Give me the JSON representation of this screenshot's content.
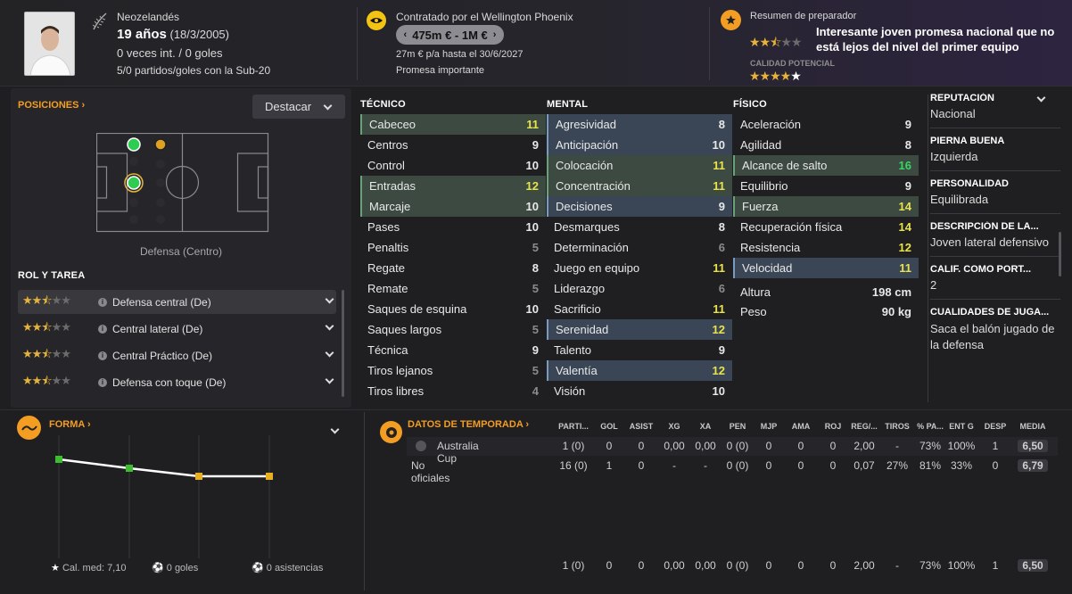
{
  "header": {
    "nationality": "Neozelandés",
    "age": "19 años",
    "dob": "(18/3/2005)",
    "caps": "0 veces int. / 0 goles",
    "u20": "5/0 partidos/goles con la Sub-20",
    "contract_title": "Contratado por el Wellington Phoenix",
    "value": "475m € - 1M €",
    "wage": "27m € p/a hasta el 30/6/2027",
    "status": "Promesa importante",
    "coach_title": "Resumen de preparador",
    "coach_report": "Interesante joven promesa nacional que no está lejos del nivel del primer equipo",
    "potential_label": "CALIDAD POTENCIAL"
  },
  "positions": {
    "title": "POSICIONES",
    "highlight": "Destacar",
    "current": "Defensa (Centro)"
  },
  "roles": {
    "title": "ROL Y TAREA",
    "items": [
      {
        "label": "Defensa central (De)"
      },
      {
        "label": "Central lateral (De)"
      },
      {
        "label": "Central Práctico (De)"
      },
      {
        "label": "Defensa con toque (De)"
      }
    ]
  },
  "technical": {
    "title": "TÉCNICO",
    "rows": [
      {
        "name": "Cabeceo",
        "value": "11"
      },
      {
        "name": "Centros",
        "value": "9"
      },
      {
        "name": "Control",
        "value": "10"
      },
      {
        "name": "Entradas",
        "value": "12"
      },
      {
        "name": "Marcaje",
        "value": "10"
      },
      {
        "name": "Pases",
        "value": "10"
      },
      {
        "name": "Penaltis",
        "value": "5"
      },
      {
        "name": "Regate",
        "value": "8"
      },
      {
        "name": "Remate",
        "value": "5"
      },
      {
        "name": "Saques de esquina",
        "value": "10"
      },
      {
        "name": "Saques largos",
        "value": "5"
      },
      {
        "name": "Técnica",
        "value": "9"
      },
      {
        "name": "Tiros lejanos",
        "value": "5"
      },
      {
        "name": "Tiros libres",
        "value": "4"
      }
    ]
  },
  "mental": {
    "title": "MENTAL",
    "rows": [
      {
        "name": "Agresividad",
        "value": "8"
      },
      {
        "name": "Anticipación",
        "value": "10"
      },
      {
        "name": "Colocación",
        "value": "11"
      },
      {
        "name": "Concentración",
        "value": "11"
      },
      {
        "name": "Decisiones",
        "value": "9"
      },
      {
        "name": "Desmarques",
        "value": "8"
      },
      {
        "name": "Determinación",
        "value": "6"
      },
      {
        "name": "Juego en equipo",
        "value": "11"
      },
      {
        "name": "Liderazgo",
        "value": "6"
      },
      {
        "name": "Sacrificio",
        "value": "11"
      },
      {
        "name": "Serenidad",
        "value": "12"
      },
      {
        "name": "Talento",
        "value": "9"
      },
      {
        "name": "Valentía",
        "value": "12"
      },
      {
        "name": "Visión",
        "value": "10"
      }
    ]
  },
  "physical": {
    "title": "FÍSICO",
    "rows": [
      {
        "name": "Aceleración",
        "value": "9"
      },
      {
        "name": "Agilidad",
        "value": "8"
      },
      {
        "name": "Alcance de salto",
        "value": "16"
      },
      {
        "name": "Equilibrio",
        "value": "9"
      },
      {
        "name": "Fuerza",
        "value": "14"
      },
      {
        "name": "Recuperación física",
        "value": "14"
      },
      {
        "name": "Resistencia",
        "value": "12"
      },
      {
        "name": "Velocidad",
        "value": "11"
      }
    ],
    "height_label": "Altura",
    "height": "198 cm",
    "weight_label": "Peso",
    "weight": "90 kg"
  },
  "info": [
    {
      "label": "REPUTACIÓN",
      "value": "Nacional"
    },
    {
      "label": "PIERNA BUENA",
      "value": "Izquierda"
    },
    {
      "label": "PERSONALIDAD",
      "value": "Equilibrada"
    },
    {
      "label": "DESCRIPCIÓN DE LA...",
      "value": "Joven lateral defensivo"
    },
    {
      "label": "CALIF. COMO PORT...",
      "value": "2"
    },
    {
      "label": "CUALIDADES DE JUGA...",
      "value": "Saca el balón jugado de la defensa"
    }
  ],
  "form": {
    "title": "FORMA",
    "avg": "Cal. med: 7,10",
    "goals": "0 goles",
    "assists": "0 asistencias"
  },
  "season": {
    "title": "DATOS DE TEMPORADA",
    "headers": [
      "PARTI...",
      "GOL",
      "ASIST",
      "XG",
      "XA",
      "PEN",
      "MJP",
      "AMA",
      "ROJ",
      "REG/...",
      "TIROS",
      "% PA...",
      "ENT G",
      "DESP",
      "MEDIA"
    ],
    "rows": [
      {
        "name": "Australia Cup",
        "cells": [
          "1 (0)",
          "0",
          "0",
          "0,00",
          "0,00",
          "0 (0)",
          "0",
          "0",
          "0",
          "2,00",
          "-",
          "73%",
          "100%",
          "1",
          "6,50"
        ]
      },
      {
        "name": "No oficiales",
        "cells": [
          "16 (0)",
          "1",
          "0",
          "-",
          "-",
          "0 (0)",
          "0",
          "0",
          "0",
          "0,07",
          "27%",
          "81%",
          "33%",
          "0",
          "6,79"
        ]
      }
    ],
    "total": [
      "1 (0)",
      "0",
      "0",
      "0,00",
      "0,00",
      "0 (0)",
      "0",
      "0",
      "0",
      "2,00",
      "-",
      "73%",
      "100%",
      "1",
      "6,50"
    ]
  }
}
